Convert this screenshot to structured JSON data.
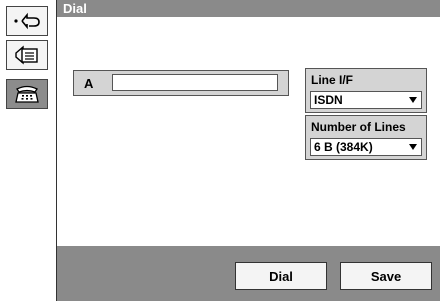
{
  "title": "Dial",
  "sidebar": {
    "items": [
      {
        "icon": "back-arrow-icon"
      },
      {
        "icon": "document-list-icon"
      },
      {
        "icon": "phone-keypad-icon",
        "selected": true
      }
    ]
  },
  "address": {
    "label": "A",
    "value": ""
  },
  "line_if": {
    "label": "Line I/F",
    "value": "ISDN"
  },
  "number_of_lines": {
    "label": "Number of Lines",
    "value": "6 B (384K)"
  },
  "footer": {
    "dial_label": "Dial",
    "save_label": "Save"
  }
}
